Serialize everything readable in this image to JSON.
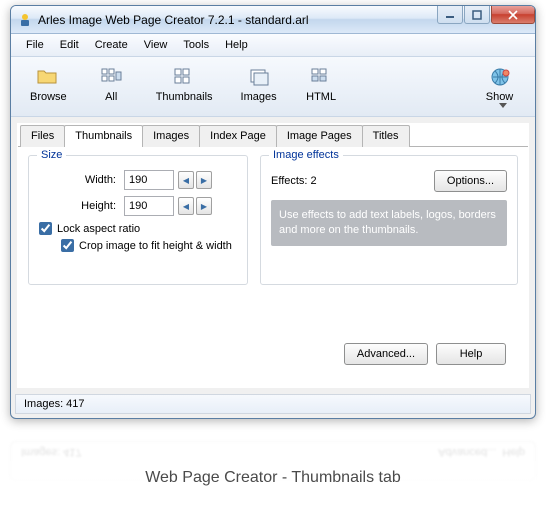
{
  "window": {
    "title": "Arles Image Web Page Creator 7.2.1 - standard.arl"
  },
  "menu": {
    "file": "File",
    "edit": "Edit",
    "create": "Create",
    "view": "View",
    "tools": "Tools",
    "help": "Help"
  },
  "toolbar": {
    "browse": "Browse",
    "all": "All",
    "thumbnails": "Thumbnails",
    "images": "Images",
    "html": "HTML",
    "show": "Show"
  },
  "tabs": {
    "files": "Files",
    "thumbnails": "Thumbnails",
    "images": "Images",
    "index_page": "Index Page",
    "image_pages": "Image Pages",
    "titles": "Titles"
  },
  "size_group": {
    "title": "Size",
    "width_label": "Width:",
    "width_value": "190",
    "height_label": "Height:",
    "height_value": "190",
    "lock_label": "Lock aspect ratio",
    "crop_label": "Crop image to fit height & width"
  },
  "effects_group": {
    "title": "Image effects",
    "effects_label": "Effects: 2",
    "options_btn": "Options...",
    "hint": "Use effects to add text labels, logos, borders and more on the thumbnails."
  },
  "buttons": {
    "advanced": "Advanced...",
    "help": "Help"
  },
  "status": {
    "images": "Images: 417"
  },
  "caption": "Web Page Creator - Thumbnails tab",
  "mirror": {
    "left": "Images: 417",
    "right1": "Advanced...",
    "right2": "Help"
  }
}
